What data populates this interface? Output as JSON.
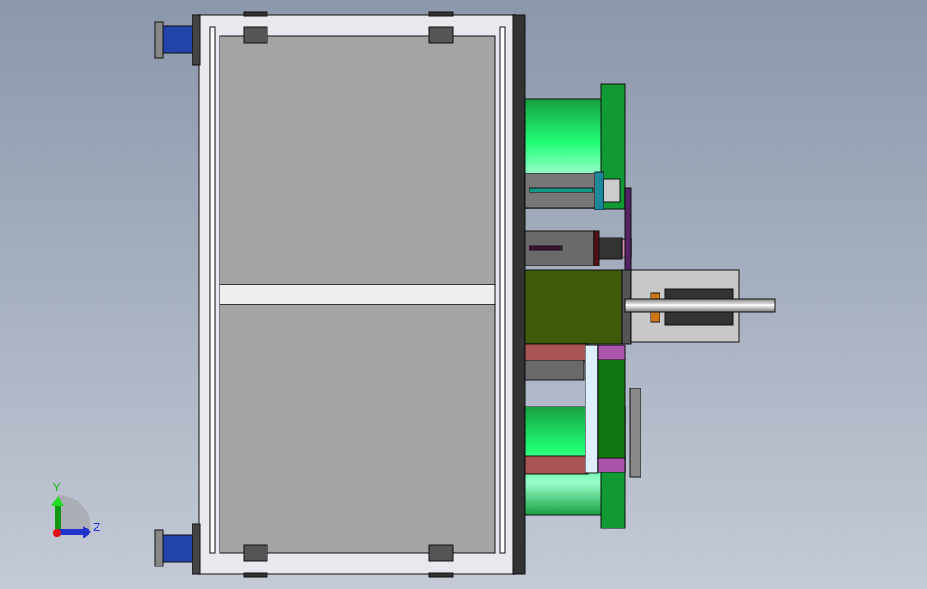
{
  "viewport": {
    "axis_triad": {
      "labels": [
        {
          "kind": "vertical",
          "text": "Y"
        },
        {
          "kind": "horizontal",
          "text": "Z"
        }
      ]
    }
  }
}
